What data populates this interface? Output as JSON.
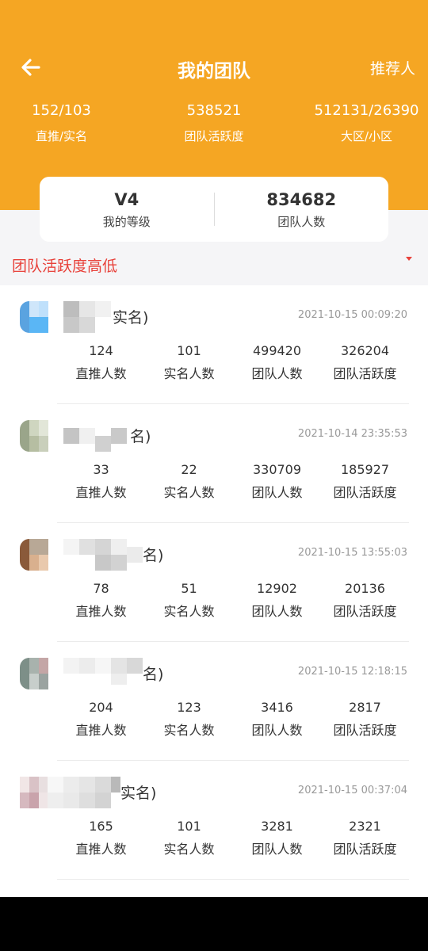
{
  "header": {
    "title": "我的团队",
    "referrer_label": "推荐人",
    "stats": [
      {
        "value": "152/103",
        "label": "直推/实名"
      },
      {
        "value": "538521",
        "label": "团队活跃度"
      },
      {
        "value": "512131/26390",
        "label": "大区/小区"
      }
    ]
  },
  "summary": {
    "level_value": "V4",
    "level_label": "我的等级",
    "team_value": "834682",
    "team_label": "团队人数"
  },
  "sort": {
    "label": "团队活跃度高低"
  },
  "members": [
    {
      "name_suffix": "实名)",
      "time": "2021-10-15 00:09:20",
      "values": [
        "124",
        "101",
        "499420",
        "326204"
      ]
    },
    {
      "name_suffix": "名)",
      "time": "2021-10-14 23:35:53",
      "values": [
        "33",
        "22",
        "330709",
        "185927"
      ]
    },
    {
      "name_suffix": "名)",
      "time": "2021-10-15 13:55:03",
      "values": [
        "78",
        "51",
        "12902",
        "20136"
      ]
    },
    {
      "name_suffix": "名)",
      "time": "2021-10-15 12:18:15",
      "values": [
        "204",
        "123",
        "3416",
        "2817"
      ]
    },
    {
      "name_suffix": "实名)",
      "time": "2021-10-15 00:37:04",
      "values": [
        "165",
        "101",
        "3281",
        "2321"
      ]
    }
  ],
  "columns": [
    "直推人数",
    "实名人数",
    "团队人数",
    "团队活跃度"
  ],
  "colors": {
    "header": "#f5a623",
    "sort": "#e8413a"
  },
  "icons": {
    "back": "arrow-left-icon"
  }
}
